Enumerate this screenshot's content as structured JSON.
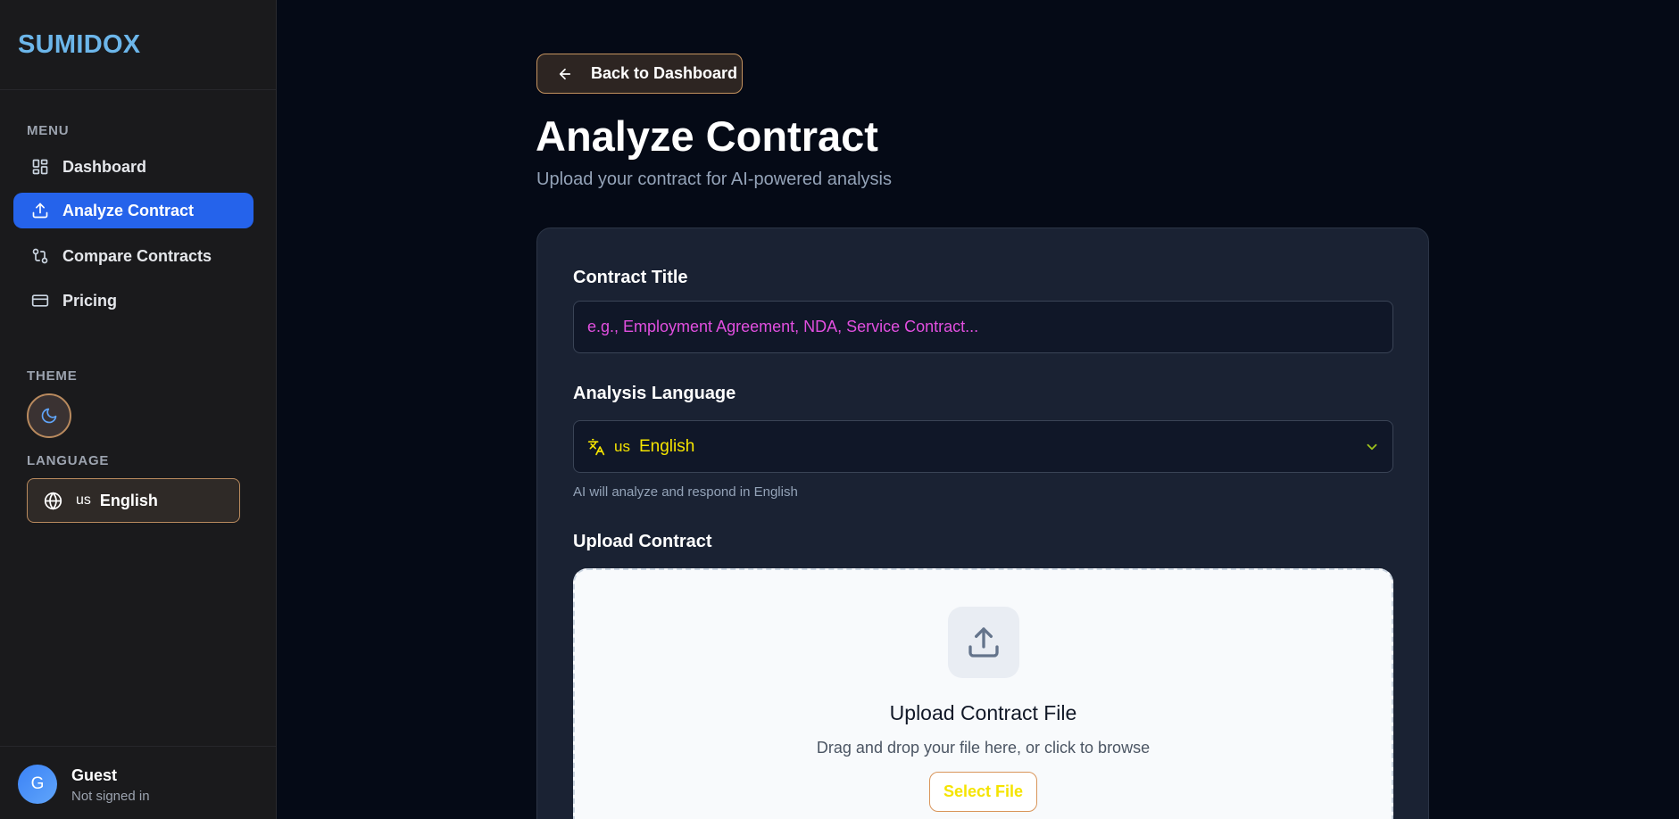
{
  "sidebar": {
    "brand": "SUMIDOX",
    "menu_label": "MENU",
    "items": [
      {
        "label": "Dashboard",
        "icon": "grid-icon"
      },
      {
        "label": "Analyze Contract",
        "icon": "upload-icon",
        "active": true
      },
      {
        "label": "Compare Contracts",
        "icon": "git-compare-icon"
      },
      {
        "label": "Pricing",
        "icon": "credit-card-icon"
      }
    ],
    "theme_label": "THEME",
    "theme_icon": "moon-icon",
    "language_label": "LANGUAGE",
    "language": {
      "flag": "us",
      "name": "English",
      "icon": "globe-icon"
    },
    "user": {
      "initial": "G",
      "name": "Guest",
      "status": "Not signed in"
    }
  },
  "main": {
    "back_label": "Back to Dashboard",
    "title": "Analyze Contract",
    "subtitle": "Upload your contract for AI-powered analysis",
    "form": {
      "contract_title_label": "Contract Title",
      "contract_title_placeholder": "e.g., Employment Agreement, NDA, Service Contract...",
      "analysis_language_label": "Analysis Language",
      "analysis_language_flag": "us",
      "analysis_language_value": "English",
      "analysis_language_helper": "AI will analyze and respond in English",
      "upload_label": "Upload Contract",
      "upload_title": "Upload Contract File",
      "upload_subtitle": "Drag and drop your file here, or click to browse",
      "select_file_label": "Select File"
    }
  },
  "colors": {
    "background": "#050a16",
    "sidebar": "#1a1a1c",
    "brand": "#6cb6ea",
    "active_nav": "#2563eb",
    "card": "#1a2233",
    "accent_border": "#c4935f",
    "placeholder": "#e24fe0",
    "select_text": "#f5e400"
  }
}
